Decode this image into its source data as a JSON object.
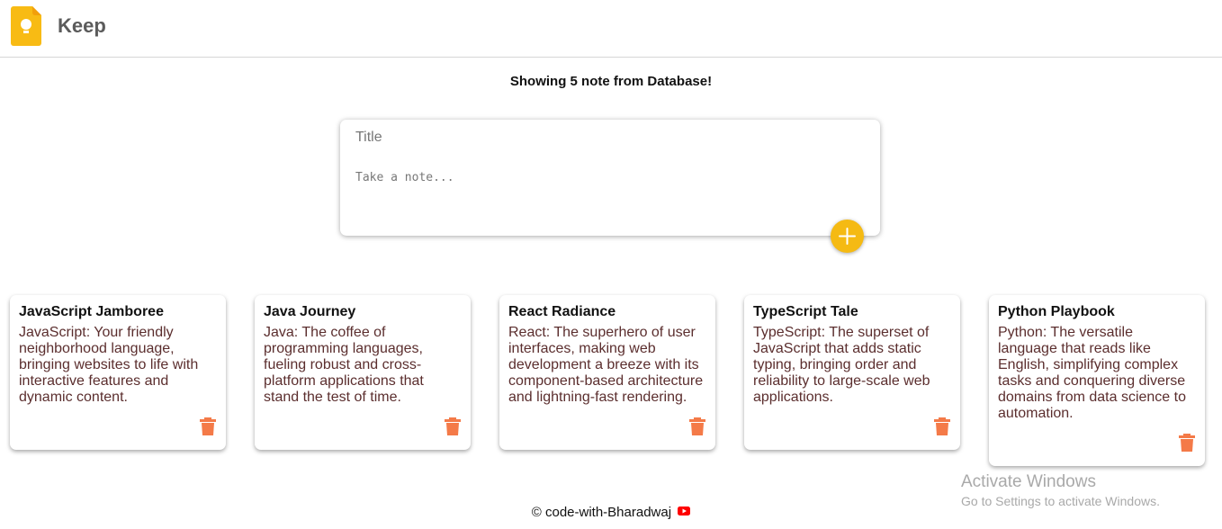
{
  "header": {
    "title": "Keep",
    "logo_icon": "keep-bulb-icon",
    "accent": "#f5ba13"
  },
  "notice": "Showing 5 note from Database!",
  "composer": {
    "title_placeholder": "Title",
    "content_placeholder": "Take a note...",
    "add_icon": "plus-icon"
  },
  "notes": [
    {
      "title": "JavaScript Jamboree",
      "content": "JavaScript: Your friendly neighborhood language, bringing websites to life with interactive features and dynamic content."
    },
    {
      "title": "Java Journey",
      "content": "Java: The coffee of programming languages, fueling robust and cross-platform applications that stand the test of time."
    },
    {
      "title": "React Radiance",
      "content": "React: The superhero of user interfaces, making web development a breeze with its component-based architecture and lightning-fast rendering."
    },
    {
      "title": "TypeScript Tale",
      "content": "TypeScript: The superset of JavaScript that adds static typing, bringing order and reliability to large-scale web applications."
    },
    {
      "title": "Python Playbook",
      "content": "Python: The versatile language that reads like English, simplifying complex tasks and conquering diverse domains from data science to automation."
    }
  ],
  "note_delete_icon": "trash-icon",
  "delete_color": "#f47a48",
  "footer": {
    "text": "© code-with-Bharadwaj",
    "icon": "youtube-icon"
  },
  "watermark": {
    "title": "Activate Windows",
    "subtitle": "Go to Settings to activate Windows."
  }
}
